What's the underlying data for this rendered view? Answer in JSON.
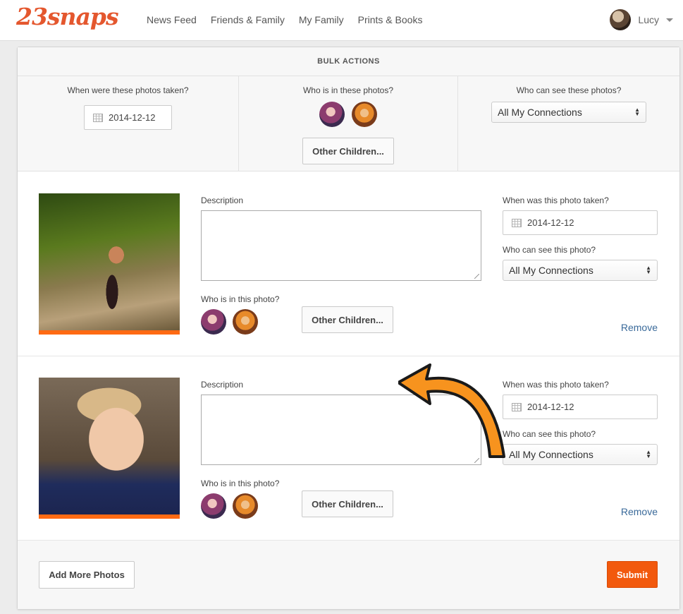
{
  "brand": {
    "logo": "23snaps"
  },
  "nav": {
    "items": [
      "News Feed",
      "Friends & Family",
      "My Family",
      "Prints & Books"
    ]
  },
  "user": {
    "name": "Lucy"
  },
  "bulk": {
    "header": "BULK ACTIONS",
    "when_label": "When were these photos taken?",
    "date": "2014-12-12",
    "who_label": "Who is in these photos?",
    "other_children": "Other Children...",
    "visibility_label": "Who can see these photos?",
    "visibility": "All My Connections"
  },
  "photos": [
    {
      "description_label": "Description",
      "who_label": "Who is in this photo?",
      "other_children": "Other Children...",
      "when_label": "When was this photo taken?",
      "date": "2014-12-12",
      "visibility_label": "Who can see this photo?",
      "visibility": "All My Connections",
      "remove": "Remove"
    },
    {
      "description_label": "Description",
      "who_label": "Who is in this photo?",
      "other_children": "Other Children...",
      "when_label": "When was this photo taken?",
      "date": "2014-12-12",
      "visibility_label": "Who can see this photo?",
      "visibility": "All My Connections",
      "remove": "Remove"
    }
  ],
  "footer": {
    "add_more": "Add More Photos",
    "submit": "Submit"
  },
  "colors": {
    "brand": "#e4572e",
    "accent": "#ff6a13",
    "submit": "#f2590d",
    "link": "#3a6a9a"
  },
  "icons": [
    "calendar-icon",
    "caret-down-icon",
    "select-arrows-icon",
    "annotation-arrow"
  ]
}
